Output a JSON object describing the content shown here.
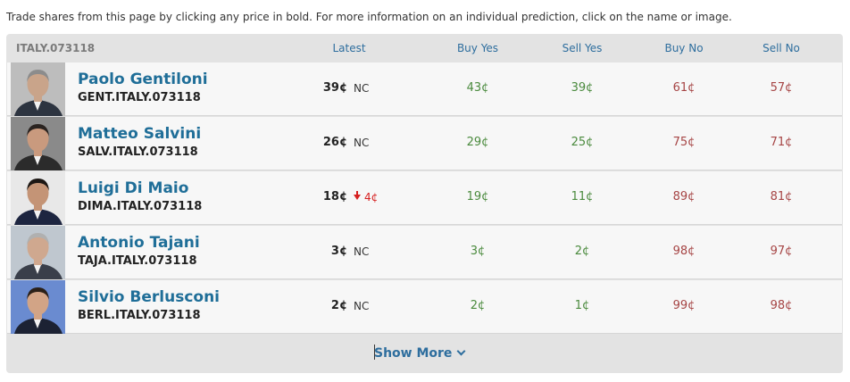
{
  "intro": "Trade shares from this page by clicking any price in bold. For more information on an individual prediction, click on the name or image.",
  "market": {
    "id": "ITALY.073118",
    "columns": {
      "latest": "Latest",
      "buy_yes": "Buy Yes",
      "sell_yes": "Sell Yes",
      "buy_no": "Buy No",
      "sell_no": "Sell No"
    },
    "contracts": [
      {
        "name": "Paolo Gentiloni",
        "ticker": "GENT.ITALY.073118",
        "latest": "39¢",
        "change": "NC",
        "change_dir": "none",
        "buy_yes": "43¢",
        "sell_yes": "39¢",
        "buy_no": "61¢",
        "sell_no": "57¢"
      },
      {
        "name": "Matteo Salvini",
        "ticker": "SALV.ITALY.073118",
        "latest": "26¢",
        "change": "NC",
        "change_dir": "none",
        "buy_yes": "29¢",
        "sell_yes": "25¢",
        "buy_no": "75¢",
        "sell_no": "71¢"
      },
      {
        "name": "Luigi Di Maio",
        "ticker": "DIMA.ITALY.073118",
        "latest": "18¢",
        "change": "4¢",
        "change_dir": "down",
        "buy_yes": "19¢",
        "sell_yes": "11¢",
        "buy_no": "89¢",
        "sell_no": "81¢"
      },
      {
        "name": "Antonio Tajani",
        "ticker": "TAJA.ITALY.073118",
        "latest": "3¢",
        "change": "NC",
        "change_dir": "none",
        "buy_yes": "3¢",
        "sell_yes": "2¢",
        "buy_no": "98¢",
        "sell_no": "97¢"
      },
      {
        "name": "Silvio Berlusconi",
        "ticker": "BERL.ITALY.073118",
        "latest": "2¢",
        "change": "NC",
        "change_dir": "none",
        "buy_yes": "2¢",
        "sell_yes": "1¢",
        "buy_no": "99¢",
        "sell_no": "98¢"
      }
    ],
    "show_more": "Show More"
  },
  "colors": {
    "name_link": "#1f6e98",
    "header_text": "#2e6e9e",
    "yes_price": "#4a8a3d",
    "no_price": "#a64545",
    "down_change": "#d62020",
    "panel_bg": "#e3e3e3",
    "row_bg": "#f7f7f7"
  },
  "icons": {
    "change_down": "down-arrow-icon",
    "show_more": "chevron-down-icon"
  }
}
